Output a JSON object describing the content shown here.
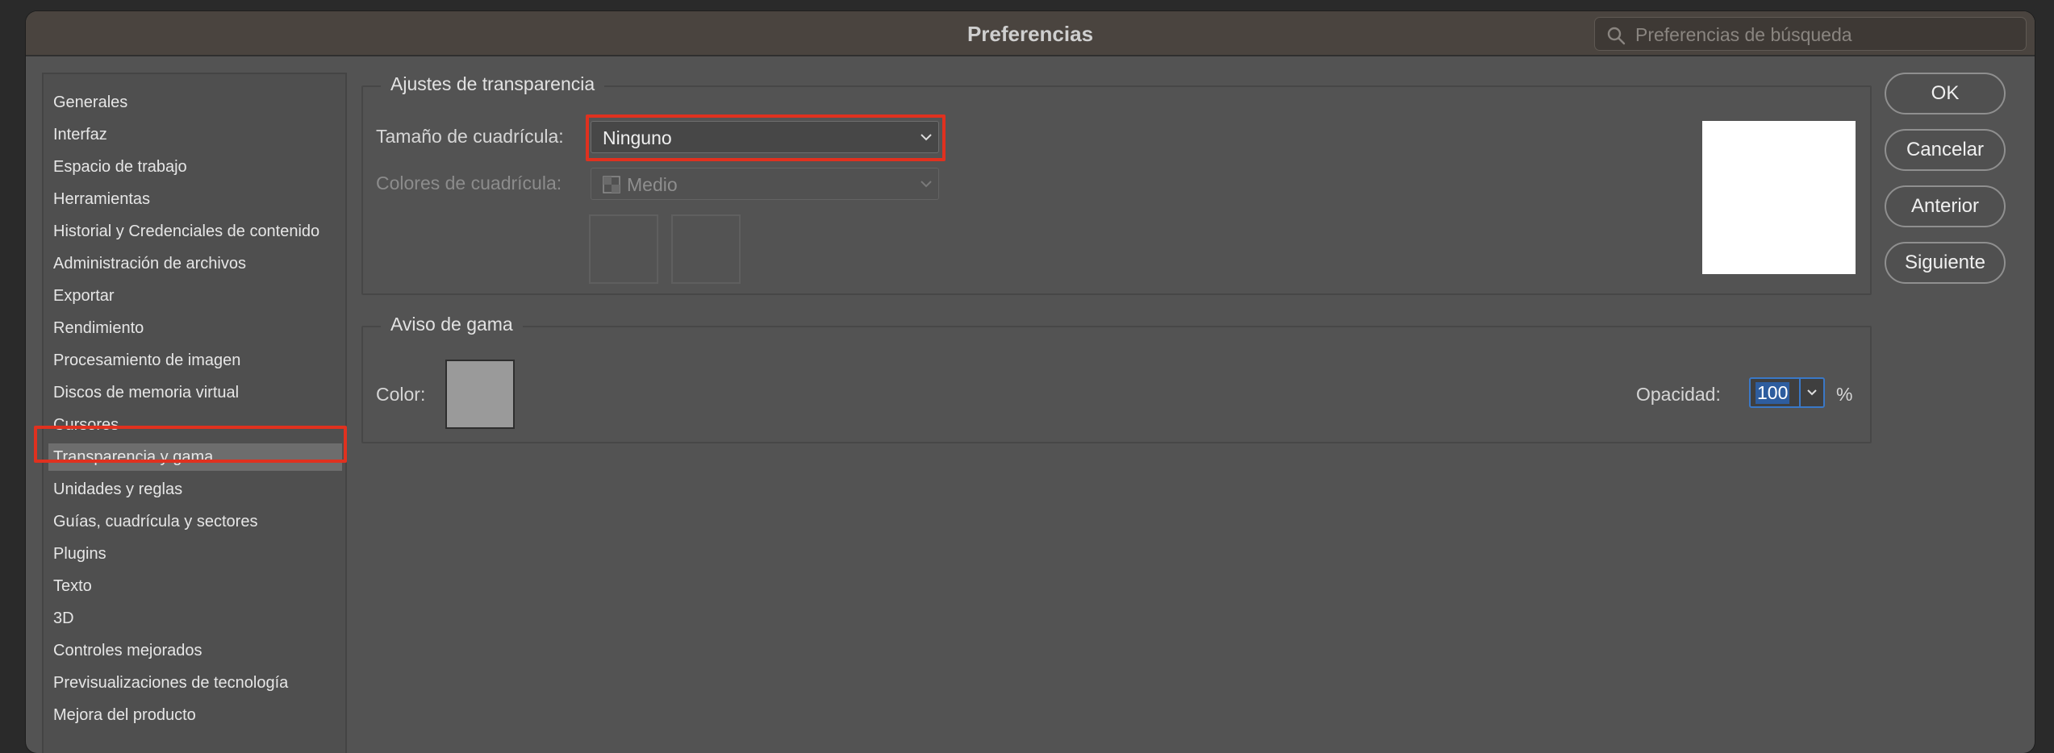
{
  "window": {
    "title": "Preferencias"
  },
  "search": {
    "placeholder": "Preferencias de búsqueda",
    "icon": "search-icon"
  },
  "sidebar": {
    "items": [
      {
        "label": "Generales"
      },
      {
        "label": "Interfaz"
      },
      {
        "label": "Espacio de trabajo"
      },
      {
        "label": "Herramientas"
      },
      {
        "label": "Historial y Credenciales de contenido"
      },
      {
        "label": "Administración de archivos"
      },
      {
        "label": "Exportar"
      },
      {
        "label": "Rendimiento"
      },
      {
        "label": "Procesamiento de imagen"
      },
      {
        "label": "Discos de memoria virtual"
      },
      {
        "label": "Cursores"
      },
      {
        "label": "Transparencia y gama",
        "selected": true
      },
      {
        "label": "Unidades y reglas"
      },
      {
        "label": "Guías, cuadrícula y sectores"
      },
      {
        "label": "Plugins"
      },
      {
        "label": "Texto"
      },
      {
        "label": "3D"
      },
      {
        "label": "Controles mejorados"
      },
      {
        "label": "Previsualizaciones de tecnología"
      },
      {
        "label": "Mejora del producto"
      }
    ]
  },
  "transparency": {
    "group_title": "Ajustes de transparencia",
    "grid_size_label": "Tamaño de cuadrícula:",
    "grid_size_value": "Ninguno",
    "grid_colors_label": "Colores de cuadrícula:",
    "grid_colors_value": "Medio"
  },
  "gamut": {
    "group_title": "Aviso de gama",
    "color_label": "Color:",
    "color_value": "#9a9a9a",
    "opacity_label": "Opacidad:",
    "opacity_value": "100",
    "opacity_unit": "%"
  },
  "buttons": {
    "ok": "OK",
    "cancel": "Cancelar",
    "previous": "Anterior",
    "next": "Siguiente"
  },
  "colors": {
    "highlight_box": "#e0311f",
    "dialog_bg": "#535353",
    "selection_bg": "#6d6d6d"
  }
}
